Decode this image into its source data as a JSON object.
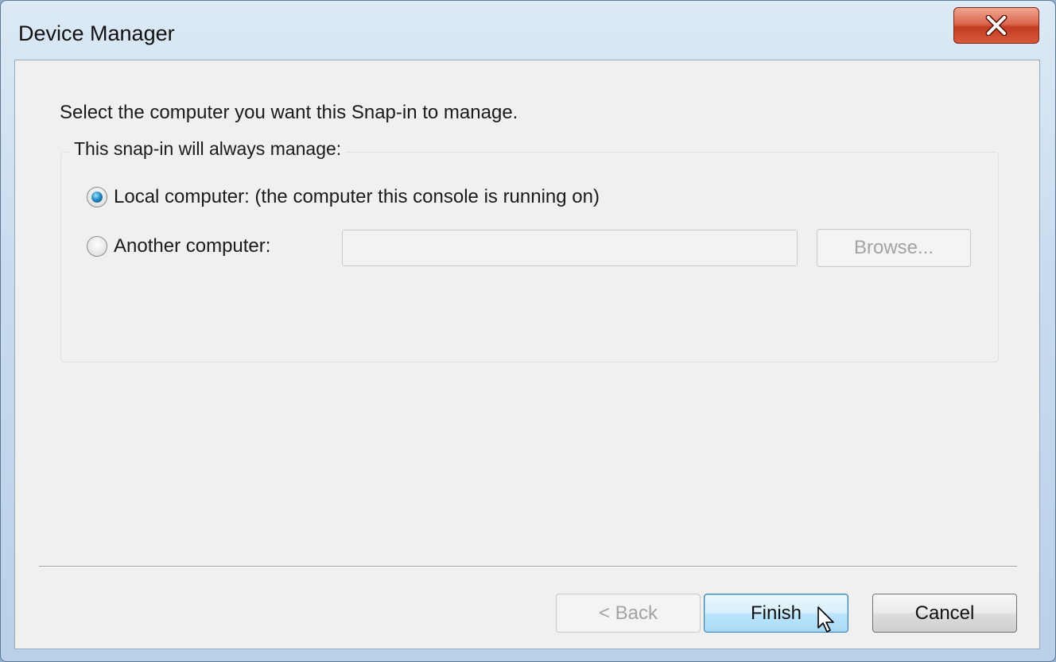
{
  "window": {
    "title": "Device Manager",
    "close_glyph": "X"
  },
  "instruction": "Select the computer you want this Snap-in to manage.",
  "group": {
    "legend": "This snap-in will always manage:",
    "local_option": {
      "label": "Local computer:  (the computer this console is running on)",
      "checked": true
    },
    "another_option": {
      "label": "Another computer:",
      "checked": false
    },
    "computer_input": {
      "value": "",
      "enabled": false
    },
    "browse_label": "Browse..."
  },
  "footer": {
    "back_label": "< Back",
    "finish_label": "Finish",
    "cancel_label": "Cancel"
  },
  "colors": {
    "radio_selected": "#2a8fc7",
    "close_button": "#c23d23",
    "focus_button": "#bee6fd"
  },
  "icons": {
    "close": "close-icon",
    "cursor": "mouse-pointer-icon"
  }
}
